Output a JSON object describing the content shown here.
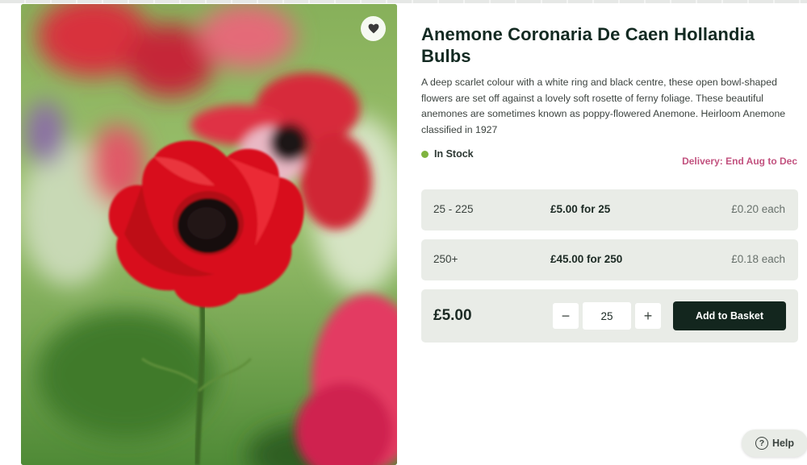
{
  "product": {
    "title": "Anemone Coronaria De Caen Hollandia Bulbs",
    "description": "A deep scarlet colour with a white ring and black centre, these open bowl-shaped flowers are set off against a lovely soft rosette of ferny foliage. These beautiful anemones are sometimes known as poppy-flowered Anemone. Heirloom Anemone classified in 1927",
    "stock_status": "In Stock",
    "delivery": "Delivery: End Aug to Dec",
    "image_icon": "red-anemone-photo",
    "favourite_icon": "heart-icon"
  },
  "price_tiers": [
    {
      "qty": "25 - 225",
      "offer": "£5.00 for 25",
      "each": "£0.20 each"
    },
    {
      "qty": "250+",
      "offer": "£45.00 for 250",
      "each": "£0.18 each"
    }
  ],
  "basket": {
    "total": "£5.00",
    "decrement": "−",
    "quantity": "25",
    "increment": "+",
    "add_label": "Add to Basket"
  },
  "help": {
    "icon": "?",
    "label": "Help"
  },
  "colors": {
    "accent_dark": "#13261e",
    "delivery_pink": "#c2527f",
    "stock_green": "#7fb33f",
    "panel_bg": "#e9ece7"
  }
}
